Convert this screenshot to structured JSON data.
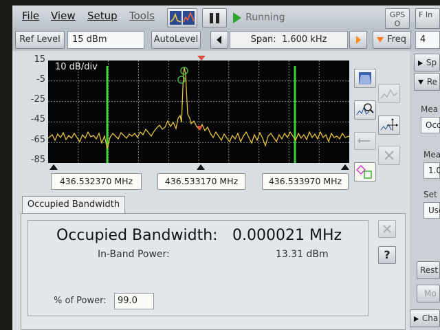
{
  "menu": {
    "file": "File",
    "view": "View",
    "setup": "Setup",
    "tools": "Tools",
    "running": "Running",
    "gps_top": "GPS",
    "gps_bottom": "O",
    "f_top": "F In"
  },
  "toolbar": {
    "ref_level_label": "Ref Level",
    "ref_level_value": "15 dBm",
    "autolevel_label": "AutoLevel",
    "span_label": "Span:",
    "span_value": "1.600 kHz",
    "freq_label": "Freq",
    "right_value": "4"
  },
  "plot": {
    "scale_label": "10 dB/div",
    "y_ticks": [
      "15",
      "-5",
      "-25",
      "-45",
      "-65",
      "-85"
    ],
    "freq_left": "436.532370 MHz",
    "freq_center": "436.533170 MHz",
    "freq_right": "436.533970 MHz"
  },
  "results": {
    "tab_label": "Occupied Bandwidth",
    "obw_label": "Occupied Bandwidth:",
    "obw_value": "0.000021 MHz",
    "inband_label": "In-Band Power:",
    "inband_value": "13.31 dBm",
    "percent_label": "% of Power:",
    "percent_value": "99.0",
    "help_label": "?"
  },
  "side_panel": {
    "item1": "Sp",
    "item2": "Re",
    "meas_label": "Mea",
    "meas_value": "Occ",
    "mea2_label": "Mea",
    "mea2_value": "1.0",
    "set_label": "Set",
    "set_value": "Use",
    "rest_label": "Rest",
    "mo_label": "Mo",
    "cha_label": "Cha"
  },
  "colors": {
    "trace": "#e8c43c",
    "marker_line": "#3cd23c",
    "plot_bg": "#050505",
    "panel": "#d9dee3"
  }
}
